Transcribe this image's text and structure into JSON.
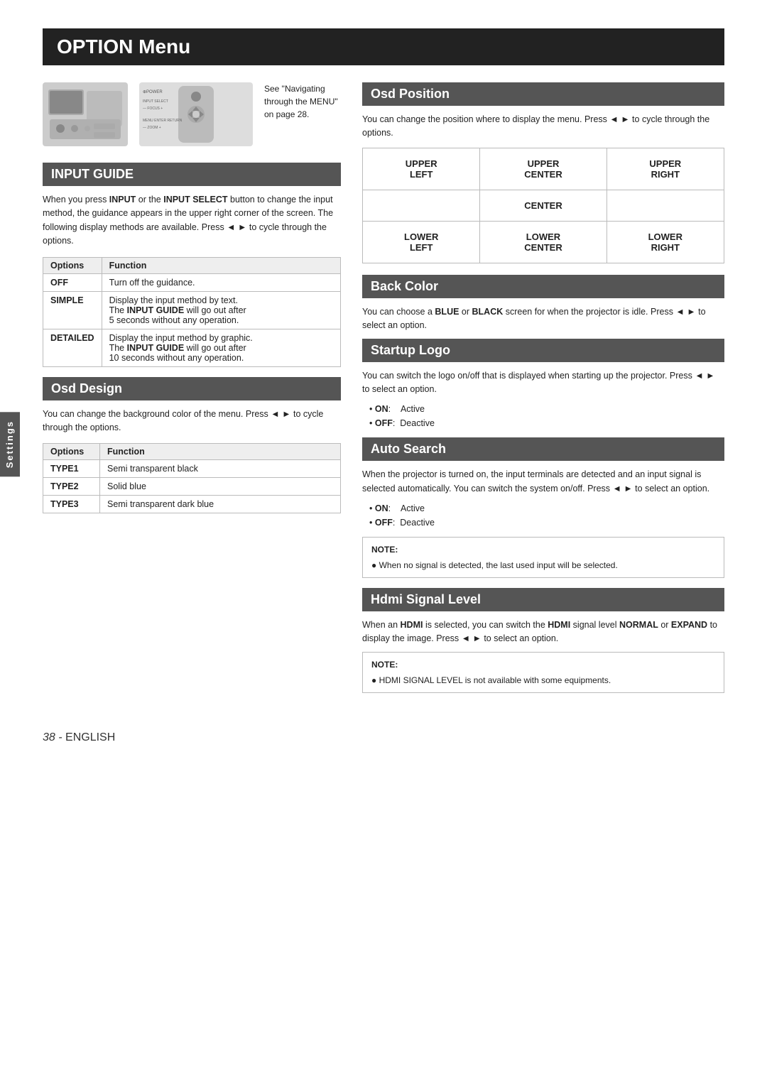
{
  "page": {
    "title": "OPTION Menu",
    "footer": "38 - English",
    "footer_prefix": "38 - ",
    "footer_suffix": "English"
  },
  "settings_tab": "Settings",
  "top_note": "See \"Navigating through the MENU\" on page 28.",
  "input_guide": {
    "header": "INPUT GUIDE",
    "description": "When you press INPUT or the INPUT SELECT button to change the input method, the guidance appears in the upper right corner of the screen. The following display methods are available. Press ◄ ► to cycle through the options.",
    "table_headers": [
      "Options",
      "Function"
    ],
    "rows": [
      {
        "option": "OFF",
        "option_bold": false,
        "function": "Turn off the guidance."
      },
      {
        "option": "SIMPLE",
        "option_bold": true,
        "function": "Display the input method by text. The INPUT GUIDE will go out after 5 seconds without any operation."
      },
      {
        "option": "DETAILED",
        "option_bold": true,
        "function": "Display the input method by graphic. The INPUT GUIDE will go out after 10 seconds without any operation."
      }
    ]
  },
  "osd_design": {
    "header": "Osd Design",
    "description": "You can change the background color of the menu. Press ◄ ► to cycle through the options.",
    "table_headers": [
      "Options",
      "Function"
    ],
    "rows": [
      {
        "option": "TYPE1",
        "function": "Semi transparent black"
      },
      {
        "option": "TYPE2",
        "function": "Solid blue"
      },
      {
        "option": "TYPE3",
        "function": "Semi transparent dark blue"
      }
    ]
  },
  "osd_position": {
    "header": "Osd Position",
    "description": "You can change the position where to display the menu. Press ◄ ► to cycle through the options.",
    "grid": [
      [
        "UPPER\nLEFT",
        "UPPER\nCENTER",
        "UPPER\nRIGHT"
      ],
      [
        "",
        "CENTER",
        ""
      ],
      [
        "LOWER\nLEFT",
        "LOWER\nCENTER",
        "LOWER\nRIGHT"
      ]
    ]
  },
  "back_color": {
    "header": "Back Color",
    "description": "You can choose a BLUE or BLACK screen for when the projector is idle. Press ◄ ► to select an option."
  },
  "startup_logo": {
    "header": "Startup Logo",
    "description": "You can switch the logo on/off that is displayed when starting up the projector. Press ◄ ► to select an option.",
    "options": [
      {
        "label": "ON",
        "value": "Active"
      },
      {
        "label": "OFF",
        "value": "Deactive"
      }
    ]
  },
  "auto_search": {
    "header": "Auto Search",
    "description": "When the projector is turned on, the input terminals are detected and an input signal is selected automatically. You can switch the system on/off. Press ◄ ► to select an option.",
    "options": [
      {
        "label": "ON",
        "value": "Active"
      },
      {
        "label": "OFF",
        "value": "Deactive"
      }
    ],
    "note": "When no signal is detected, the last used input will be selected."
  },
  "hdmi_signal_level": {
    "header": "Hdmi Signal Level",
    "description": "When an HDMI is selected, you can switch the HDMI signal level NORMAL or EXPAND to display the image. Press ◄ ► to select an option.",
    "note": "HDMI SIGNAL LEVEL is not available with some equipments."
  }
}
